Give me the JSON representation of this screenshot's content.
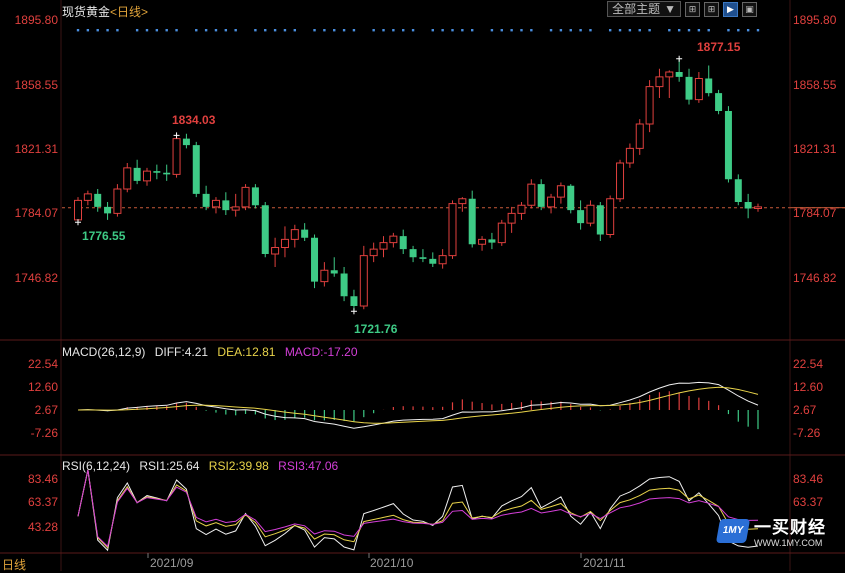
{
  "header": {
    "title": "现货黄金",
    "period_bracket": "<日线>",
    "theme_select": "全部主题",
    "controls": [
      "⊞",
      "⊞",
      "▶",
      "▣"
    ]
  },
  "main_chart": {
    "ylabels": [
      "1895.80",
      "1858.55",
      "1821.31",
      "1784.07",
      "1746.82"
    ],
    "ylim": [
      1709,
      1901
    ],
    "last_price": 1785.5,
    "annotations": {
      "high1": "1834.03",
      "low1": "1776.55",
      "low2": "1721.76",
      "high2": "1877.15"
    },
    "colors": {
      "up": "#e0403e",
      "down": "#3ecb86",
      "dotted": "#4a8fe0"
    }
  },
  "macd": {
    "label": "MACD(26,12,9)",
    "diff": "DIFF:4.21",
    "dea": "DEA:12.81",
    "macd": "MACD:-17.20",
    "ylabels": [
      "22.54",
      "12.60",
      "2.67",
      "-7.26"
    ]
  },
  "rsi": {
    "label": "RSI(6,12,24)",
    "rsi1": "RSI1:25.64",
    "rsi2": "RSI2:39.98",
    "rsi3": "RSI3:47.06",
    "ylabels": [
      "83.46",
      "63.37",
      "43.28"
    ]
  },
  "xaxis": {
    "period": "日线",
    "labels": [
      "2021/09",
      "2021/10",
      "2021/11"
    ]
  },
  "watermark": {
    "badge": "1MY",
    "name": "一买财经",
    "url": "WWW.1MY.COM"
  },
  "chart_data": {
    "type": "candlestick",
    "title": "现货黄金",
    "series": [
      {
        "name": "K",
        "ohlc": [
          [
            1778,
            1792,
            1776.55,
            1790
          ],
          [
            1790,
            1796,
            1787,
            1794
          ],
          [
            1794,
            1797,
            1783,
            1786
          ],
          [
            1786,
            1789,
            1778,
            1782
          ],
          [
            1782,
            1800,
            1780,
            1797
          ],
          [
            1797,
            1813,
            1795,
            1810
          ],
          [
            1810,
            1815,
            1800,
            1802
          ],
          [
            1802,
            1810,
            1799,
            1808
          ],
          [
            1808,
            1812,
            1803,
            1807
          ],
          [
            1807,
            1812,
            1802,
            1806
          ],
          [
            1806,
            1830,
            1804,
            1828
          ],
          [
            1828,
            1831,
            1822,
            1824
          ],
          [
            1824,
            1826,
            1792,
            1794
          ],
          [
            1794,
            1799,
            1784,
            1786
          ],
          [
            1786,
            1792,
            1782,
            1790
          ],
          [
            1790,
            1795,
            1781,
            1784
          ],
          [
            1784,
            1794,
            1780,
            1786
          ],
          [
            1786,
            1800,
            1784,
            1798
          ],
          [
            1798,
            1800,
            1785,
            1787
          ],
          [
            1787,
            1789,
            1755,
            1757
          ],
          [
            1757,
            1767,
            1749,
            1761
          ],
          [
            1761,
            1774,
            1755,
            1766
          ],
          [
            1766,
            1775,
            1761,
            1772
          ],
          [
            1772,
            1776,
            1765,
            1767
          ],
          [
            1767,
            1769,
            1736,
            1740
          ],
          [
            1740,
            1752,
            1737,
            1747
          ],
          [
            1747,
            1755,
            1743,
            1745
          ],
          [
            1745,
            1749,
            1728,
            1731
          ],
          [
            1731,
            1735,
            1721.76,
            1725
          ],
          [
            1725,
            1762,
            1723,
            1756
          ],
          [
            1756,
            1764,
            1752,
            1760
          ],
          [
            1760,
            1768,
            1755,
            1764
          ],
          [
            1764,
            1770,
            1761,
            1768
          ],
          [
            1768,
            1772,
            1757,
            1760
          ],
          [
            1760,
            1762,
            1752,
            1755
          ],
          [
            1755,
            1760,
            1752,
            1754
          ],
          [
            1754,
            1758,
            1749,
            1751
          ],
          [
            1751,
            1760,
            1748,
            1756
          ],
          [
            1756,
            1790,
            1754,
            1788
          ],
          [
            1788,
            1792,
            1783,
            1791
          ],
          [
            1791,
            1796,
            1761,
            1763
          ],
          [
            1763,
            1768,
            1759,
            1766
          ],
          [
            1766,
            1770,
            1760,
            1764
          ],
          [
            1764,
            1778,
            1762,
            1776
          ],
          [
            1776,
            1786,
            1770,
            1782
          ],
          [
            1782,
            1789,
            1778,
            1787
          ],
          [
            1787,
            1803,
            1785,
            1800
          ],
          [
            1800,
            1803,
            1784,
            1786
          ],
          [
            1786,
            1794,
            1782,
            1792
          ],
          [
            1792,
            1801,
            1788,
            1799
          ],
          [
            1799,
            1800,
            1782,
            1784
          ],
          [
            1784,
            1790,
            1772,
            1776
          ],
          [
            1776,
            1790,
            1774,
            1787
          ],
          [
            1787,
            1789,
            1765,
            1769
          ],
          [
            1769,
            1793,
            1767,
            1791
          ],
          [
            1791,
            1815,
            1789,
            1813
          ],
          [
            1813,
            1825,
            1810,
            1822
          ],
          [
            1822,
            1840,
            1818,
            1837
          ],
          [
            1837,
            1864,
            1832,
            1860
          ],
          [
            1860,
            1871,
            1853,
            1866
          ],
          [
            1866,
            1870,
            1853,
            1869
          ],
          [
            1869,
            1877.15,
            1863,
            1866
          ],
          [
            1866,
            1871,
            1849,
            1852
          ],
          [
            1852,
            1869,
            1850,
            1865
          ],
          [
            1865,
            1873,
            1854,
            1856
          ],
          [
            1856,
            1858,
            1843,
            1845
          ],
          [
            1845,
            1848,
            1801,
            1803
          ],
          [
            1803,
            1806,
            1787,
            1789
          ],
          [
            1789,
            1794,
            1779,
            1785
          ],
          [
            1785,
            1788,
            1783,
            1786
          ]
        ]
      }
    ],
    "x_labels": [
      "2021/09",
      "2021/10",
      "2021/11"
    ],
    "ylim": [
      1709,
      1901
    ]
  }
}
